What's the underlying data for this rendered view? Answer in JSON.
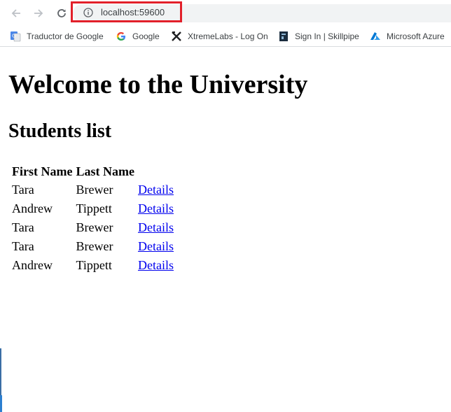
{
  "browser": {
    "address": "localhost:59600",
    "bookmarks": [
      {
        "label": "Traductor de Google",
        "icon": "google-translate-icon"
      },
      {
        "label": "Google",
        "icon": "google-g-icon"
      },
      {
        "label": "XtremeLabs - Log On",
        "icon": "xtremelabs-x-icon"
      },
      {
        "label": "Sign In | Skillpipe",
        "icon": "skillpipe-icon"
      },
      {
        "label": "Microsoft Azure",
        "icon": "azure-icon"
      }
    ],
    "highlight_color": "#e2202a"
  },
  "page": {
    "title": "Welcome to the University",
    "subtitle": "Students list",
    "table": {
      "headers": [
        "First Name",
        "Last Name",
        ""
      ],
      "rows": [
        {
          "first": "Tara",
          "last": "Brewer",
          "link": "Details"
        },
        {
          "first": "Andrew",
          "last": "Tippett",
          "link": "Details"
        },
        {
          "first": "Tara",
          "last": "Brewer",
          "link": "Details"
        },
        {
          "first": "Tara",
          "last": "Brewer",
          "link": "Details"
        },
        {
          "first": "Andrew",
          "last": "Tippett",
          "link": "Details"
        }
      ]
    },
    "link_color": "#0000ee"
  }
}
